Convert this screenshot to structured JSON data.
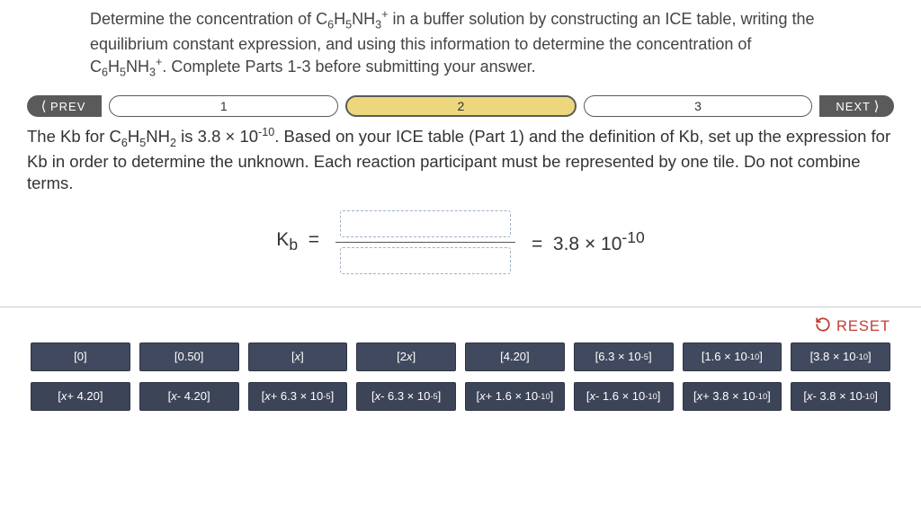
{
  "question_html": "Determine the concentration of C<sub>6</sub>H<sub>5</sub>NH<sub>3</sub><sup>+</sup> in a buffer solution by constructing an ICE table, writing the equilibrium constant expression, and using this information to determine the concentration of C<sub>6</sub>H<sub>5</sub>NH<sub>3</sub><sup>+</sup>. Complete Parts 1-3 before submitting your answer.",
  "nav": {
    "prev": "PREV",
    "next": "NEXT",
    "steps": [
      "1",
      "2",
      "3"
    ],
    "active_index": 1
  },
  "prompt_html": "The Kb for C<sub>6</sub>H<sub>5</sub>NH<sub>2</sub> is 3.8 &times; 10<sup>-10</sup>. Based on your ICE table (Part 1) and the definition of Kb, set up the expression for Kb in order to determine the unknown. Each reaction participant must be represented by one tile. Do not combine terms.",
  "equation": {
    "lhs_html": "K<sub>b</sub>&nbsp;&nbsp;=",
    "rhs_html": "=&nbsp;&nbsp;3.8 &times; 10<sup>-10</sup>"
  },
  "reset": "RESET",
  "tiles_row1": [
    "[0]",
    "[0.50]",
    "[<span class='it'>x</span>]",
    "[2<span class='it'>x</span>]",
    "[4.20]",
    "[6.3 &times; 10<sup>-5</sup>]",
    "[1.6 &times; 10<sup>-10</sup>]",
    "[3.8 &times; 10<sup>-10</sup>]"
  ],
  "tiles_row2": [
    "[<span class='it'>x</span> + 4.20]",
    "[<span class='it'>x</span> - 4.20]",
    "[<span class='it'>x</span> + 6.3 &times; 10<sup>-5</sup>]",
    "[<span class='it'>x</span> - 6.3 &times; 10<sup>-5</sup>]",
    "[<span class='it'>x</span> + 1.6 &times; 10<sup>-10</sup>]",
    "[<span class='it'>x</span> - 1.6 &times; 10<sup>-10</sup>]",
    "[<span class='it'>x</span> + 3.8 &times; 10<sup>-10</sup>]",
    "[<span class='it'>x</span> - 3.8 &times; 10<sup>-10</sup>]"
  ]
}
